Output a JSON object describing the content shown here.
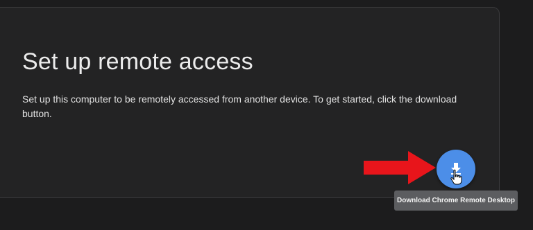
{
  "card": {
    "title": "Set up remote access",
    "description": "Set up this computer to be remotely accessed from another device. To get started, click the download button."
  },
  "download_button": {
    "icon": "download-icon",
    "tooltip": "Download Chrome Remote Desktop"
  },
  "annotation": {
    "icon": "red-arrow-icon"
  },
  "colors": {
    "background": "#1c1c1d",
    "card": "#232324",
    "accent": "#4c8ee8",
    "arrow": "#e8151b",
    "tooltip": "#5c5d60"
  }
}
